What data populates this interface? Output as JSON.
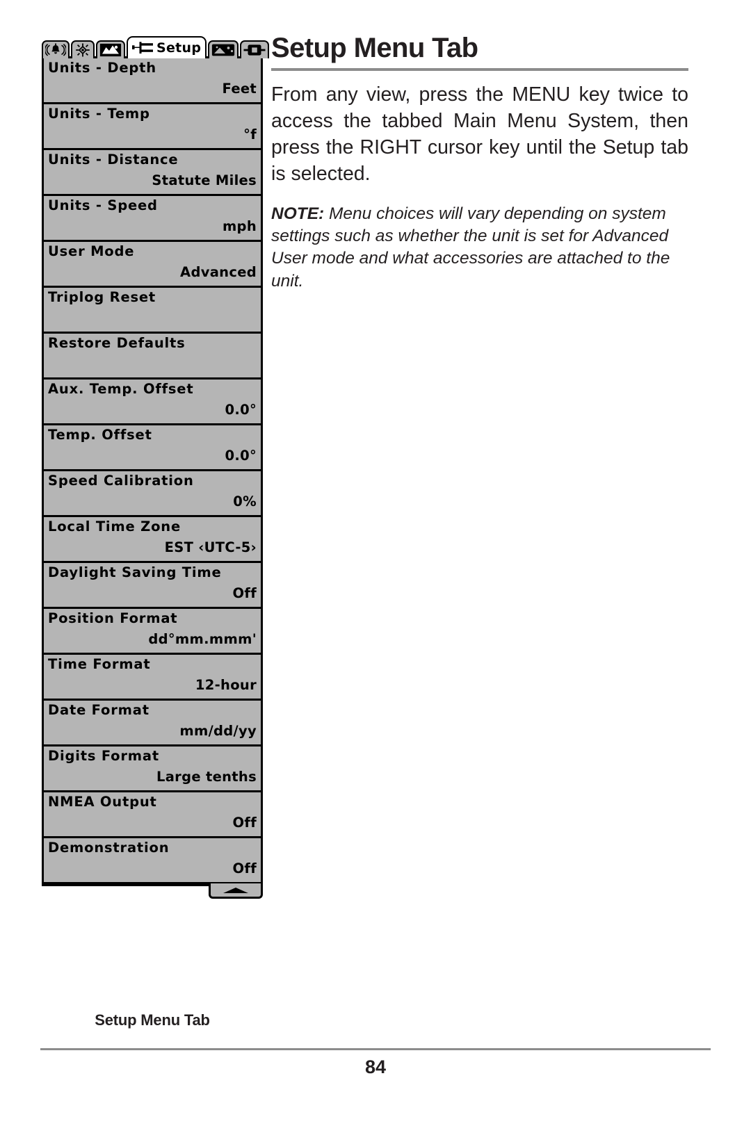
{
  "document": {
    "page_title": "Setup Menu Tab",
    "page_number": "84",
    "body_paragraph": "From any view, press the MENU key twice to access the tabbed Main Menu System, then press the RIGHT cursor key until the Setup tab is selected.",
    "note": {
      "label": "NOTE:",
      "text": " Menu choices will vary depending on system settings such as whether the unit is set for Advanced User mode and what accessories are attached to the unit."
    }
  },
  "figure": {
    "caption": "Setup Menu Tab",
    "colors": {
      "lcd_background": "#b5b5b5",
      "lcd_foreground": "#000000",
      "selected_tab_background": "#ffffff",
      "rule_gray": "#8c8c8c",
      "text_black": "#231f20"
    },
    "tabs": [
      {
        "icon": "alarm-bell-icon",
        "label": "",
        "selected": false
      },
      {
        "icon": "sonar-sun-icon",
        "label": "",
        "selected": false
      },
      {
        "icon": "navigation-chart-icon",
        "label": "",
        "selected": false
      },
      {
        "icon": "setup-wrench-icon",
        "label": "Setup",
        "selected": true
      },
      {
        "icon": "views-screen-icon",
        "label": "",
        "selected": false
      },
      {
        "icon": "accessories-connector-icon",
        "label": "",
        "selected": false
      }
    ],
    "scroll_indicator": "scroll-up-arrow",
    "menu_items": [
      {
        "label": "Units - Depth",
        "value": "Feet"
      },
      {
        "label": "Units - Temp",
        "value": "°f"
      },
      {
        "label": "Units - Distance",
        "value": "Statute Miles"
      },
      {
        "label": "Units - Speed",
        "value": "mph"
      },
      {
        "label": "User Mode",
        "value": "Advanced"
      },
      {
        "label": "Triplog Reset",
        "value": ""
      },
      {
        "label": "Restore Defaults",
        "value": ""
      },
      {
        "label": "Aux. Temp. Offset",
        "value": "0.0°"
      },
      {
        "label": "Temp. Offset",
        "value": "0.0°"
      },
      {
        "label": "Speed Calibration",
        "value": "0%"
      },
      {
        "label": "Local Time Zone",
        "value": "EST ‹UTC-5›"
      },
      {
        "label": "Daylight Saving Time",
        "value": "Off"
      },
      {
        "label": "Position Format",
        "value": "dd°mm.mmm'"
      },
      {
        "label": "Time Format",
        "value": "12-hour"
      },
      {
        "label": "Date Format",
        "value": "mm/dd/yy"
      },
      {
        "label": "Digits Format",
        "value": "Large tenths"
      },
      {
        "label": "NMEA Output",
        "value": "Off"
      },
      {
        "label": "Demonstration",
        "value": "Off"
      }
    ]
  }
}
